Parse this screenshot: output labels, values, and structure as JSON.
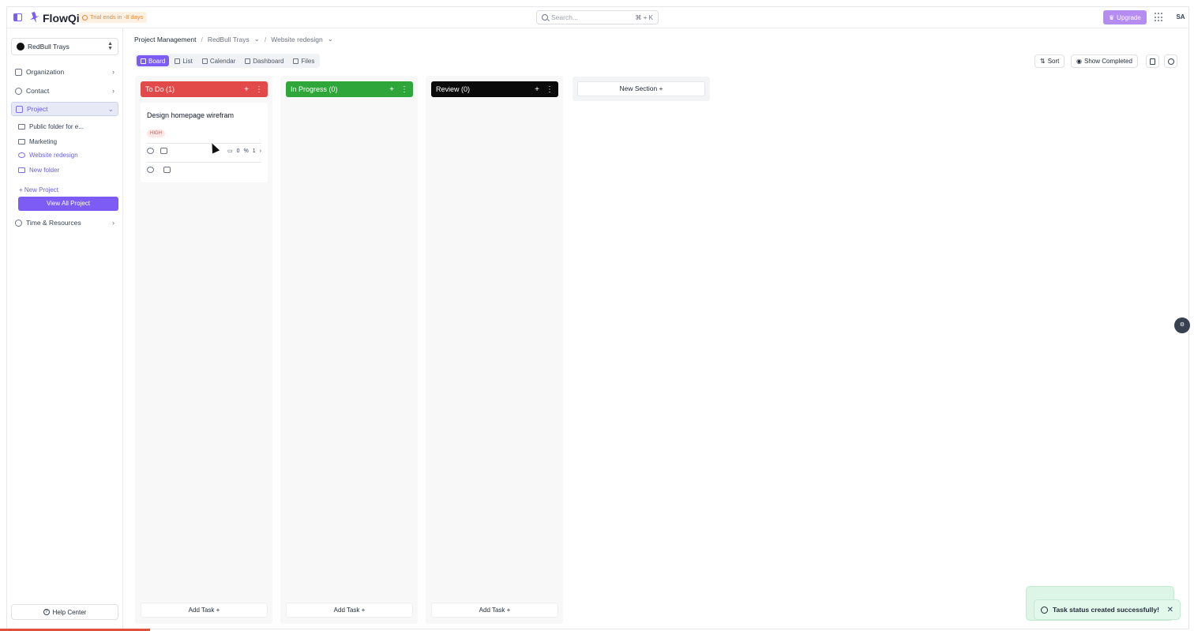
{
  "app": {
    "name": "FlowQi",
    "trial": "Trial ends in -8 days"
  },
  "search": {
    "placeholder": "Search...",
    "shortcut": "⌘ + K"
  },
  "header": {
    "upgrade": "Upgrade",
    "avatar": "SA"
  },
  "sidebar": {
    "workspace": "RedBull Trays",
    "items": [
      {
        "label": "Organization"
      },
      {
        "label": "Contact"
      },
      {
        "label": "Project"
      },
      {
        "label": "Time & Resources"
      }
    ],
    "project_children": [
      {
        "label": "Public folder for e..."
      },
      {
        "label": "Marketing"
      },
      {
        "label": "Website redesign"
      },
      {
        "label": "New folder"
      }
    ],
    "new_project": "+ New Project",
    "view_all": "View All Project",
    "help": "Help Center"
  },
  "breadcrumb": {
    "root": "Project Management",
    "workspace": "RedBull Trays",
    "project": "Website redesign"
  },
  "views": [
    {
      "label": "Board"
    },
    {
      "label": "List"
    },
    {
      "label": "Calendar"
    },
    {
      "label": "Dashboard"
    },
    {
      "label": "Files"
    }
  ],
  "toolbar": {
    "sort": "Sort",
    "show_completed": "Show Completed"
  },
  "columns": [
    {
      "title": "To Do (1)",
      "color": "#e24a4a",
      "add_task": "Add Task"
    },
    {
      "title": "In Progress (0)",
      "color": "#2ea63a",
      "add_task": "Add Task"
    },
    {
      "title": "Review (0)",
      "color": "#0a0a0a",
      "add_task": "Add Task"
    }
  ],
  "card": {
    "title": "Design homepage wirefram",
    "priority": "HIGH",
    "comments": "0",
    "subtasks": "1"
  },
  "new_section": "New Section",
  "toast": {
    "message": "Task status created successfully!"
  }
}
